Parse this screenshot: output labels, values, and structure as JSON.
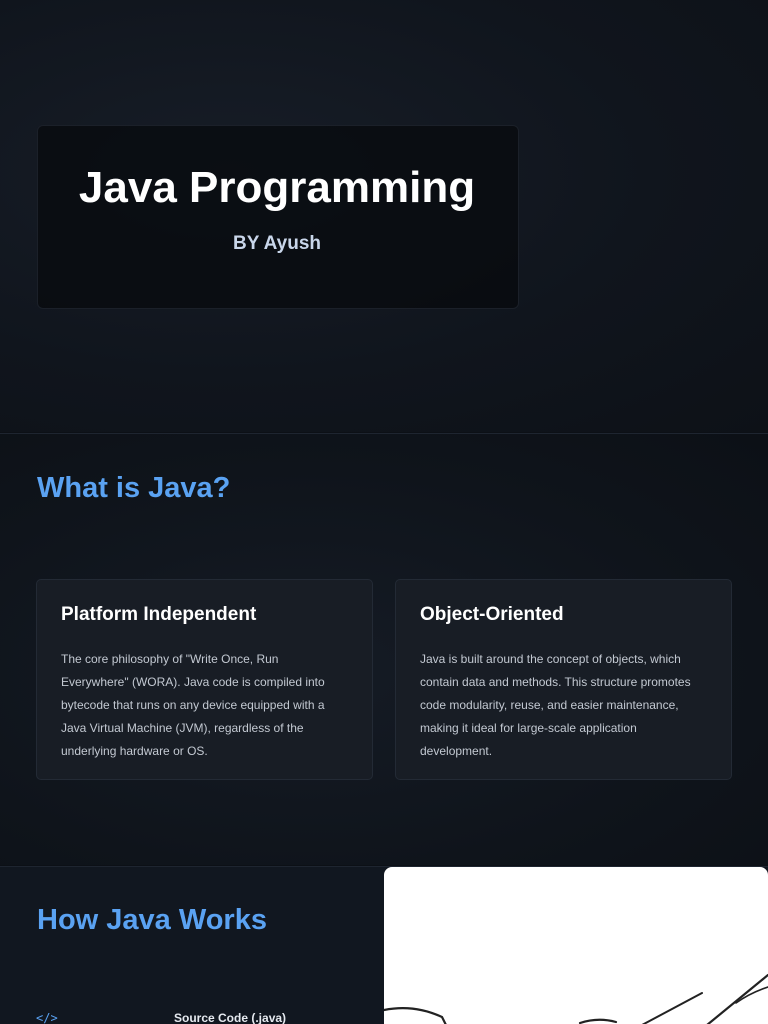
{
  "title_slide": {
    "title": "Java Programming",
    "author": "BY Ayush"
  },
  "what_is_java": {
    "heading": "What is Java?",
    "cards": [
      {
        "title": "Platform Independent",
        "body": "The core philosophy of \"Write Once, Run Everywhere\" (WORA). Java code is compiled into bytecode that runs on any device equipped with a Java Virtual Machine (JVM), regardless of the underlying hardware or OS."
      },
      {
        "title": "Object-Oriented",
        "body": "Java is built around the concept of objects, which contain data and methods. This structure promotes code modularity, reuse, and easier maintenance, making it ideal for large-scale application development."
      }
    ]
  },
  "how_java_works": {
    "heading": "How Java Works",
    "icon": "code-icon",
    "icon_glyph": "</>",
    "step_label": "Source Code (.java)"
  },
  "colors": {
    "accent": "#5aa2f2",
    "background": "#0c1016",
    "card": "#181d25"
  }
}
